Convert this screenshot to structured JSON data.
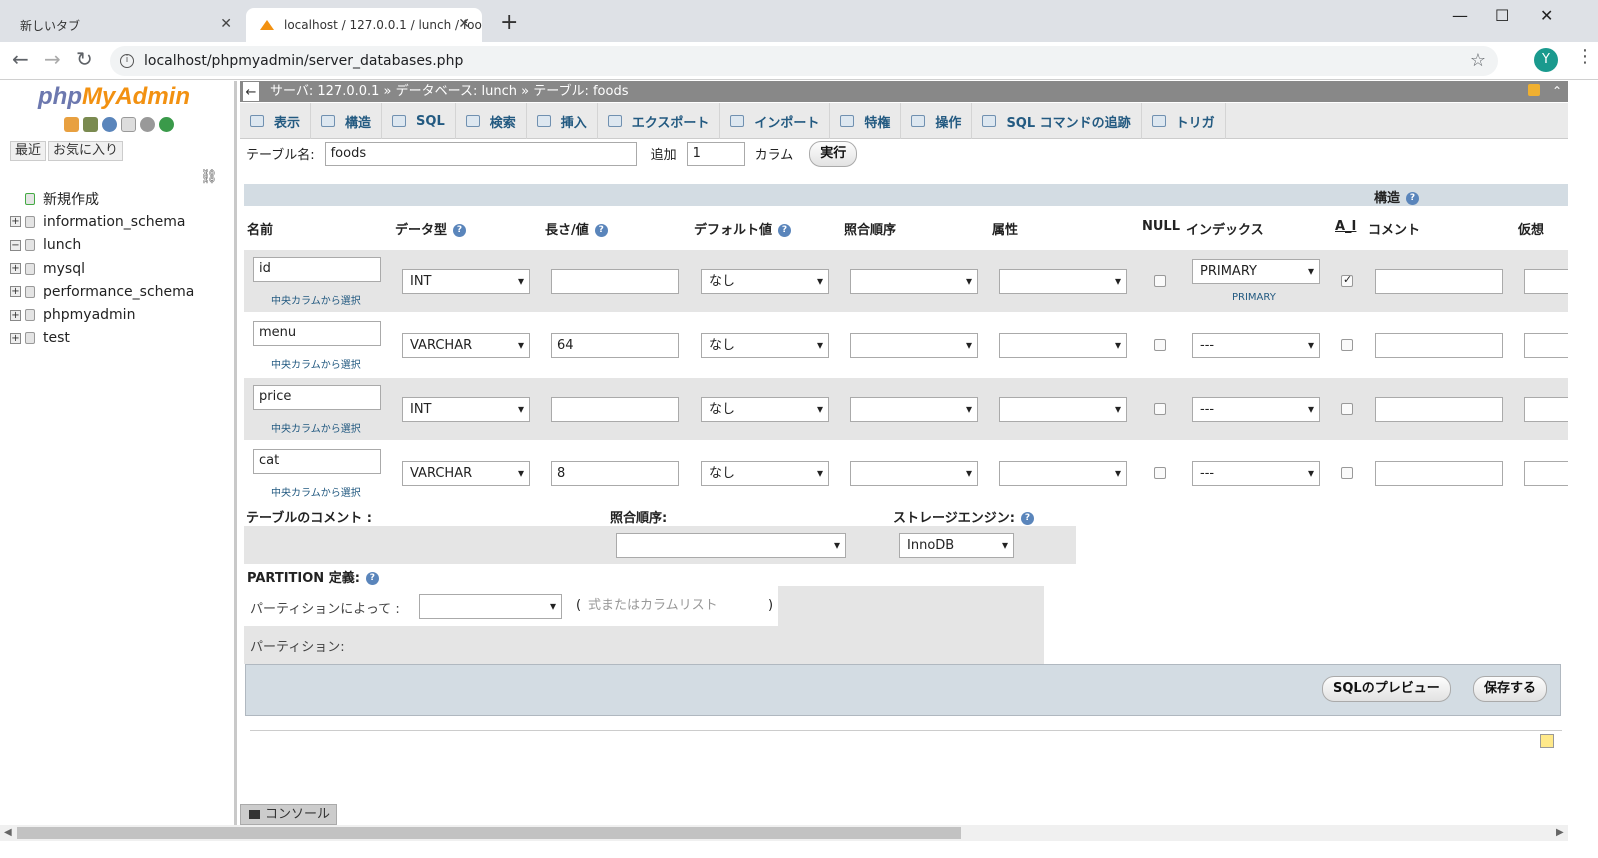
{
  "browser": {
    "tabs": [
      {
        "title": "新しいタブ",
        "close": "✕"
      },
      {
        "title": "localhost / 127.0.0.1 / lunch / foo",
        "close": "✕"
      }
    ],
    "new_tab": "+",
    "window_controls": {
      "minimize": "—",
      "maximize": "☐",
      "close": "✕"
    },
    "url": "localhost/phpmyadmin/server_databases.php",
    "nav": {
      "back": "←",
      "forward": "→",
      "reload": "↻"
    },
    "avatar_letter": "Y",
    "star": "☆",
    "menu": "⋮"
  },
  "sidebar": {
    "logo_php": "php",
    "logo_myadmin": "MyAdmin",
    "quick_icons": [
      "home-icon",
      "database-icon",
      "help-icon",
      "docs-icon",
      "settings-icon",
      "reload-icon"
    ],
    "tabs": [
      {
        "label": "最近"
      },
      {
        "label": "お気に入り"
      }
    ],
    "link_icon": "⛓",
    "tree": [
      {
        "label": "新規作成",
        "expand": ""
      },
      {
        "label": "information_schema",
        "expand": "+"
      },
      {
        "label": "lunch",
        "expand": "−"
      },
      {
        "label": "mysql",
        "expand": "+"
      },
      {
        "label": "performance_schema",
        "expand": "+"
      },
      {
        "label": "phpmyadmin",
        "expand": "+"
      },
      {
        "label": "test",
        "expand": "+"
      }
    ]
  },
  "breadcrumb": {
    "back": "←",
    "server": "サーバ: 127.0.0.1",
    "sep": "»",
    "database": "データベース: lunch",
    "table": "テーブル: foods",
    "collapse": "⌃"
  },
  "menu_tabs": [
    {
      "label": "表示",
      "icon": "browse-icon"
    },
    {
      "label": "構造",
      "icon": "structure-icon"
    },
    {
      "label": "SQL",
      "icon": "sql-icon"
    },
    {
      "label": "検索",
      "icon": "search-icon"
    },
    {
      "label": "挿入",
      "icon": "insert-icon"
    },
    {
      "label": "エクスポート",
      "icon": "export-icon"
    },
    {
      "label": "インポート",
      "icon": "import-icon"
    },
    {
      "label": "特権",
      "icon": "privileges-icon"
    },
    {
      "label": "操作",
      "icon": "operations-icon"
    },
    {
      "label": "SQL コマンドの追跡",
      "icon": "tracking-icon"
    },
    {
      "label": "トリガ",
      "icon": "triggers-icon"
    }
  ],
  "table_name": {
    "label": "テーブル名:",
    "value": "foods",
    "add_label": "追加",
    "add_value": "1",
    "columns_label": "カラム",
    "go_button": "実行"
  },
  "structure_header": "構造",
  "columns": {
    "name": "名前",
    "type": "データ型",
    "length": "長さ/値",
    "default": "デフォルト値",
    "collation": "照合順序",
    "attributes": "属性",
    "null": "NULL",
    "index": "インデックス",
    "ai": "A_I",
    "comment": "コメント",
    "virtual": "仮想"
  },
  "central_columns_link": "中央カラムから選択",
  "fields": [
    {
      "name": "id",
      "type": "INT",
      "length": "",
      "default": "なし",
      "collation": "",
      "attribute": "",
      "null": false,
      "index": "PRIMARY",
      "index_sub": "PRIMARY",
      "ai": true,
      "comment": ""
    },
    {
      "name": "menu",
      "type": "VARCHAR",
      "length": "64",
      "default": "なし",
      "collation": "",
      "attribute": "",
      "null": false,
      "index": "---",
      "index_sub": "",
      "ai": false,
      "comment": ""
    },
    {
      "name": "price",
      "type": "INT",
      "length": "",
      "default": "なし",
      "collation": "",
      "attribute": "",
      "null": false,
      "index": "---",
      "index_sub": "",
      "ai": false,
      "comment": ""
    },
    {
      "name": "cat",
      "type": "VARCHAR",
      "length": "8",
      "default": "なし",
      "collation": "",
      "attribute": "",
      "null": false,
      "index": "---",
      "index_sub": "",
      "ai": false,
      "comment": ""
    }
  ],
  "table_options": {
    "comment_label": "テーブルのコメント :",
    "collation_label": "照合順序:",
    "engine_label": "ストレージエンジン:",
    "engine_value": "InnoDB"
  },
  "partition": {
    "title": "PARTITION 定義:",
    "by_label": "パーティションによって :",
    "expr_placeholder": "式またはカラムリスト",
    "open_paren": "(",
    "close_paren": ")",
    "partitions_label": "パーティション:"
  },
  "actions": {
    "preview": "SQLのプレビュー",
    "save": "保存する"
  },
  "console_label": "コンソール"
}
